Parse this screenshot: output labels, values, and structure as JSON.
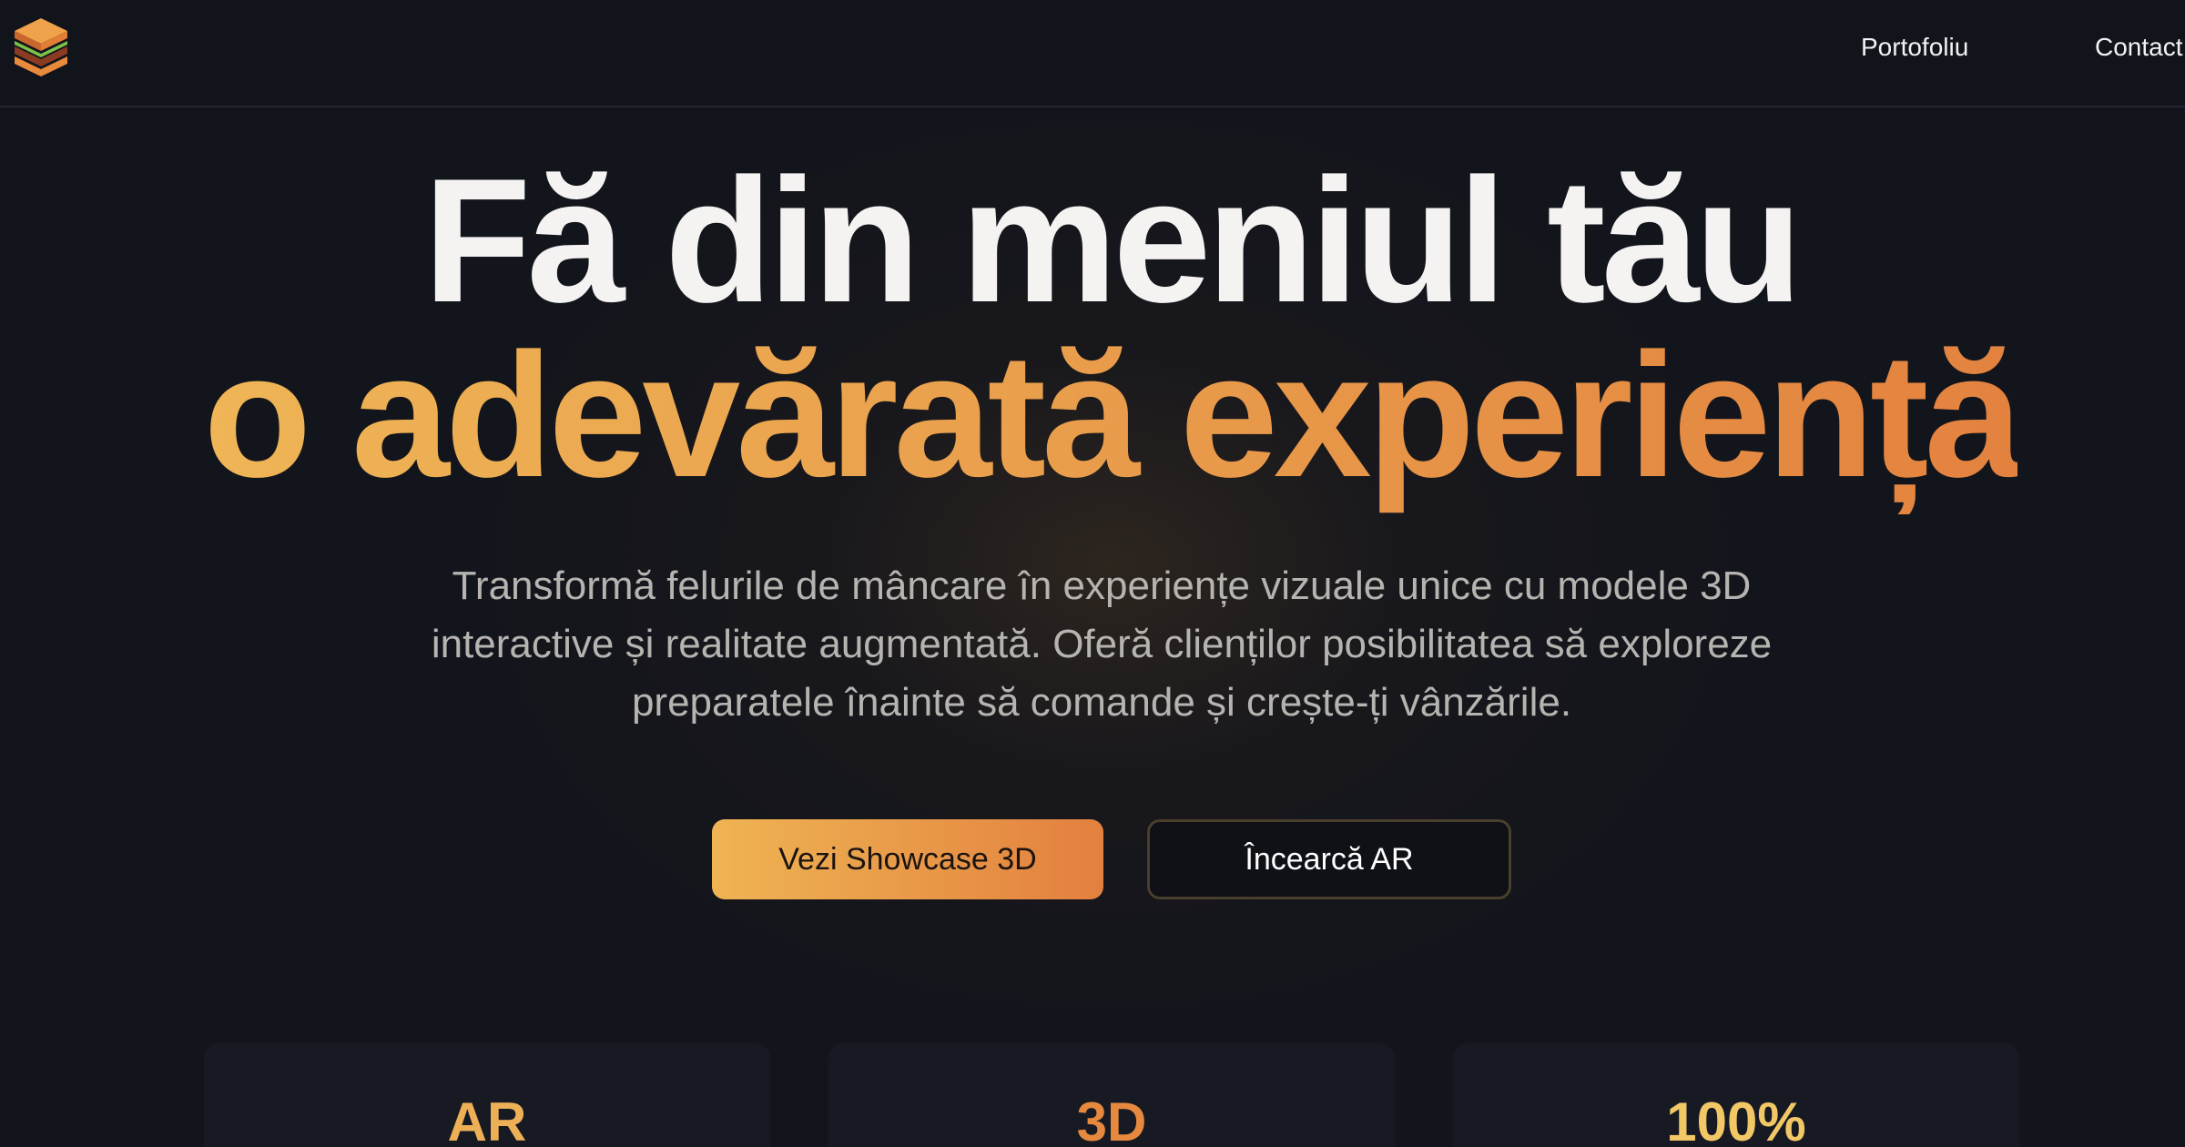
{
  "header": {
    "logo_icon": "burger-icon",
    "nav": [
      {
        "label": "Portofoliu"
      },
      {
        "label": "Contact"
      }
    ]
  },
  "hero": {
    "title_line_1": "Fă din meniul tău",
    "title_line_2": "o adevărată experiență",
    "subtitle": "Transformă felurile de mâncare în experiențe vizuale unice cu modele 3D interactive și realitate augmentată. Oferă clienților posibilitatea să exploreze preparatele înainte să comande și crește-ți vânzările."
  },
  "buttons": {
    "primary_label": "Vezi Showcase 3D",
    "secondary_label": "Încearcă AR"
  },
  "stats": [
    {
      "value": "AR"
    },
    {
      "value": "3D"
    },
    {
      "value": "100%"
    }
  ],
  "colors": {
    "background": "#13151c",
    "accent_start": "#efb556",
    "accent_end": "#e3823f",
    "text_primary": "#f4f3f1",
    "text_muted": "#b6b4b0"
  }
}
